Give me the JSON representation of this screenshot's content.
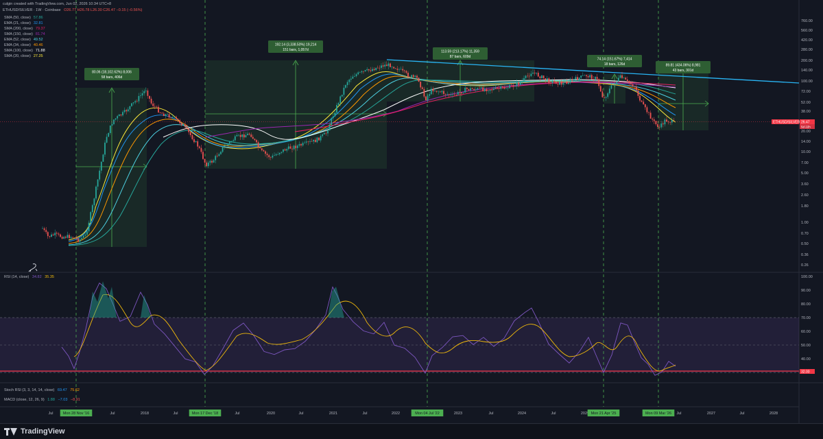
{
  "header": {
    "author_line": "culgin created with TradingView.com, Jun 02, 2026 10:34 UTC+8",
    "symbol": "ETHUSD/SILVER · 1W · Coinbase",
    "ohlc": "O26.77 H26.78 L26.30 C26.47 −0.15 (−0.56%)"
  },
  "legend": [
    {
      "label": "SMA (50, close)",
      "value": "57.86",
      "color": "#26a69a"
    },
    {
      "label": "EMA (21, close)",
      "value": "32.81",
      "color": "#2196f3"
    },
    {
      "label": "SMA (200, close)",
      "value": "79.37",
      "color": "#e91e63"
    },
    {
      "label": "SMA (150, close)",
      "value": "81.74",
      "color": "#9c27b0"
    },
    {
      "label": "EMA (52, close)",
      "value": "49.52",
      "color": "#4dd0e1"
    },
    {
      "label": "EMA (34, close)",
      "value": "40.46",
      "color": "#ff9800"
    },
    {
      "label": "SMA (100, close)",
      "value": "71.88",
      "color": "#ffffff"
    },
    {
      "label": "SMA (20, close)",
      "value": "27.25",
      "color": "#ffeb3b"
    }
  ],
  "price_axis": [
    "760.00",
    "560.00",
    "420.00",
    "280.00",
    "200.00",
    "140.00",
    "100.00",
    "72.00",
    "52.00",
    "38.00",
    "20.00",
    "14.00",
    "10.00",
    "7.00",
    "5.00",
    "3.60",
    "2.60",
    "1.80",
    "1.00",
    "0.70",
    "0.50",
    "0.36",
    "0.26"
  ],
  "rsi_axis": [
    "100.00",
    "90.00",
    "80.00",
    "70.00",
    "60.00",
    "50.00",
    "40.00",
    "30.00"
  ],
  "last_price": {
    "symbol": "ETHUSD/SILVER",
    "price": "26.47",
    "countdown": "5d 22h"
  },
  "rsi_marker": "32.00",
  "time_axis": [
    "Jul",
    "Mon 28 Nov '16",
    "Jul",
    "2018",
    "Jul",
    "Mon 17 Dec '18",
    "Jul",
    "2020",
    "Jul",
    "2021",
    "Jul",
    "2022",
    "Mon 04 Jul '22",
    "2023",
    "Jul",
    "2024",
    "Jul",
    "2025",
    "Mon 21 Apr '25",
    "Mon 09 Mar '26",
    "Jul",
    "2027",
    "Jul",
    "2028"
  ],
  "measurements": [
    {
      "line1": "80.06 (18,102.62%) 8,006",
      "line2": "58 bars, 406d"
    },
    {
      "line1": "192.14 (3,338.50%) 19,214",
      "line2": "151 bars, 1,057d"
    },
    {
      "line1": "113.59 (213.17%) 11,359",
      "line2": "87 bars, 609d"
    },
    {
      "line1": "74.14 (151.67%) 7,414",
      "line2": "18 bars, 126d"
    },
    {
      "line1": "89.81 (434.06%) 8,981",
      "line2": "43 bars, 301d"
    }
  ],
  "indicators": {
    "rsi": {
      "label": "RSI (14, close)",
      "v1": "34.82",
      "v2": "35.35"
    },
    "stoch_rsi": {
      "label": "Stoch RSI (3, 3, 14, 14, close)",
      "v1": "69.47",
      "v2": "75.62"
    },
    "macd": {
      "label": "MACD (close, 12, 26, 9)",
      "v1": "1.88",
      "v2": "−7.03",
      "v3": "−8.91"
    }
  },
  "brand": "TradingView",
  "colors": {
    "background": "#131722",
    "up": "#26a69a",
    "down": "#ef5350",
    "rsi": "#7e57c2",
    "trendline": "#29b6f6",
    "measure": "#4caf50",
    "marker": "#f23645"
  }
}
